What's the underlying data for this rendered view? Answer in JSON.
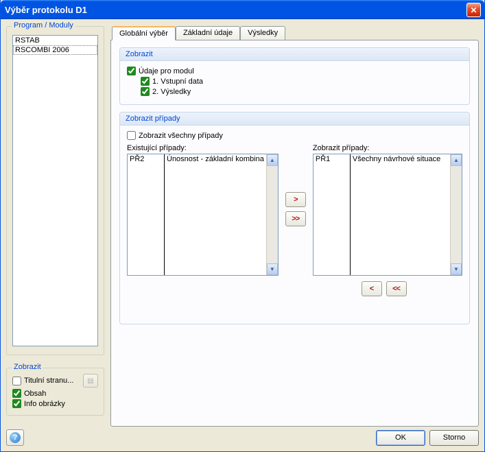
{
  "window": {
    "title": "Výběr protokolu D1"
  },
  "left": {
    "group_title": "Program / Moduly",
    "modules": [
      "RSTAB",
      "RSCOMBI 2006"
    ],
    "selected_index": 1,
    "zobrazit_title": "Zobrazit",
    "checks": {
      "titul": "Titulní stranu...",
      "obsah": "Obsah",
      "info": "Info obrázky"
    }
  },
  "tabs": {
    "items": [
      "Globální výběr",
      "Základní údaje",
      "Výsledky"
    ],
    "active": 0
  },
  "sec_zobrazit": {
    "title": "Zobrazit",
    "modul": "Údaje pro modul",
    "vstup": "1. Vstupní data",
    "vysl": "2. Výsledky"
  },
  "sec_cases": {
    "title": "Zobrazit případy",
    "all": "Zobrazit všechny případy",
    "existing_label": "Existující případy:",
    "show_label": "Zobrazit případy:",
    "existing": [
      {
        "code": "PŘ2",
        "desc": "Únosnost - základní kombina"
      }
    ],
    "shown": [
      {
        "code": "PŘ1",
        "desc": "Všechny návrhové situace"
      }
    ]
  },
  "footer": {
    "ok": "OK",
    "storno": "Storno"
  },
  "glyphs": {
    "right": ">",
    "right2": ">>",
    "left": "<",
    "left2": "<<",
    "up": "▲",
    "down": "▼"
  }
}
